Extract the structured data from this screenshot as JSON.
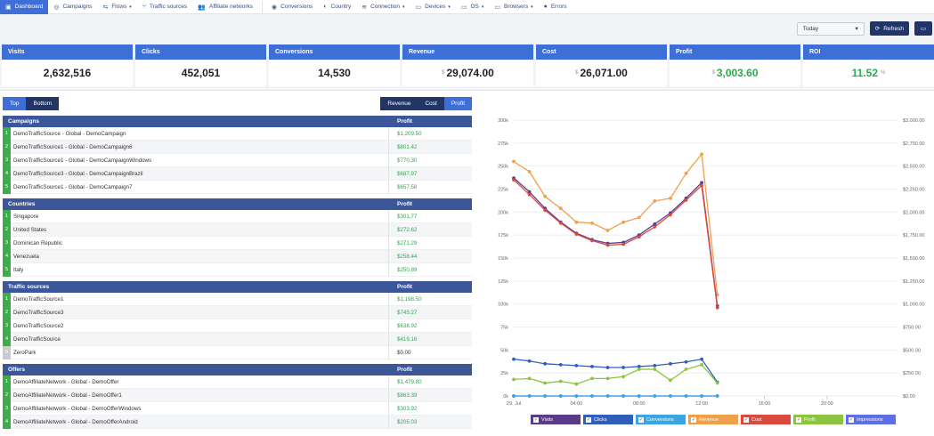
{
  "nav": {
    "items": [
      {
        "label": "Dashboard",
        "icon": "dashboard-icon",
        "glyph": "▣",
        "active": true,
        "caret": false
      },
      {
        "label": "Campaigns",
        "icon": "globe-icon",
        "glyph": "◎",
        "active": false,
        "caret": false
      },
      {
        "label": "Flows",
        "icon": "flows-icon",
        "glyph": "⇆",
        "active": false,
        "caret": true
      },
      {
        "label": "Traffic sources",
        "icon": "traffic-icon",
        "glyph": "⑂",
        "active": false,
        "caret": false
      },
      {
        "label": "Affiliate networks",
        "icon": "users-icon",
        "glyph": "👥",
        "active": false,
        "caret": false
      },
      {
        "label": "Conversions",
        "icon": "conversions-icon",
        "glyph": "◉",
        "active": false,
        "caret": false
      },
      {
        "label": "Country",
        "icon": "country-icon",
        "glyph": "◐",
        "active": false,
        "caret": false
      },
      {
        "label": "Connection",
        "icon": "wifi-icon",
        "glyph": "≋",
        "active": false,
        "caret": true
      },
      {
        "label": "Devices",
        "icon": "devices-icon",
        "glyph": "▭",
        "active": false,
        "caret": true
      },
      {
        "label": "OS",
        "icon": "os-icon",
        "glyph": "▭",
        "active": false,
        "caret": true
      },
      {
        "label": "Browsers",
        "icon": "browsers-icon",
        "glyph": "▭",
        "active": false,
        "caret": true
      },
      {
        "label": "Errors",
        "icon": "errors-icon",
        "glyph": "●",
        "active": false,
        "caret": false
      }
    ]
  },
  "toolbar": {
    "range": "Today",
    "refresh": "Refresh"
  },
  "stats": [
    {
      "label": "Visits",
      "value": "2,632,516",
      "currency": "",
      "suffix": "",
      "positive": false
    },
    {
      "label": "Clicks",
      "value": "452,051",
      "currency": "",
      "suffix": "",
      "positive": false
    },
    {
      "label": "Conversions",
      "value": "14,530",
      "currency": "",
      "suffix": "",
      "positive": false
    },
    {
      "label": "Revenue",
      "value": "29,074.00",
      "currency": "$",
      "suffix": "",
      "positive": false
    },
    {
      "label": "Cost",
      "value": "26,071.00",
      "currency": "$",
      "suffix": "",
      "positive": false
    },
    {
      "label": "Profit",
      "value": "3,003.60",
      "currency": "$",
      "suffix": "",
      "positive": true
    },
    {
      "label": "ROI",
      "value": "11.52",
      "currency": "",
      "suffix": "%",
      "positive": true
    }
  ],
  "tabs_left": [
    {
      "label": "Top",
      "active": true
    },
    {
      "label": "Bottom",
      "active": false
    }
  ],
  "tabs_right": [
    {
      "label": "Revenue",
      "active": false
    },
    {
      "label": "Cost",
      "active": false
    },
    {
      "label": "Profit",
      "active": true
    }
  ],
  "reports": [
    {
      "title": "Campaigns",
      "metric": "Profit",
      "rows": [
        {
          "rank": "1",
          "name": "DemoTrafficSource - Global - DemoCampaign",
          "value": "$1,209.50"
        },
        {
          "rank": "2",
          "name": "DemoTrafficSource1 - Global - DemoCampaign6",
          "value": "$801.42"
        },
        {
          "rank": "3",
          "name": "DemoTrafficSource1 - Global - DemoCampaignWindows",
          "value": "$770.30"
        },
        {
          "rank": "4",
          "name": "DemoTrafficSource3 - Global - DemoCampaignBrazil",
          "value": "$687.97"
        },
        {
          "rank": "5",
          "name": "DemoTrafficSource1 - Global - DemoCampaign7",
          "value": "$657.58"
        }
      ]
    },
    {
      "title": "Countries",
      "metric": "Profit",
      "rows": [
        {
          "rank": "1",
          "name": "Singapore",
          "value": "$301.77"
        },
        {
          "rank": "2",
          "name": "United States",
          "value": "$272.62"
        },
        {
          "rank": "3",
          "name": "Dominican Republic",
          "value": "$271.29"
        },
        {
          "rank": "4",
          "name": "Venezuela",
          "value": "$258.44"
        },
        {
          "rank": "5",
          "name": "Italy",
          "value": "$250.89"
        }
      ]
    },
    {
      "title": "Traffic sources",
      "metric": "Profit",
      "rows": [
        {
          "rank": "1",
          "name": "DemoTrafficSource1",
          "value": "$1,198.50"
        },
        {
          "rank": "2",
          "name": "DemoTrafficSource3",
          "value": "$745.27"
        },
        {
          "rank": "3",
          "name": "DemoTrafficSource2",
          "value": "$638.92"
        },
        {
          "rank": "4",
          "name": "DemoTrafficSource",
          "value": "$419.16"
        },
        {
          "rank": "5",
          "name": "ZeroPark",
          "value": "$0.00",
          "grey": true
        }
      ]
    },
    {
      "title": "Offers",
      "metric": "Profit",
      "rows": [
        {
          "rank": "1",
          "name": "DemoAffiliateNetwork - Global - DemoOffer",
          "value": "$1,479.80"
        },
        {
          "rank": "2",
          "name": "DemoAffiliateNetwork - Global - DemoOffer1",
          "value": "$863.39"
        },
        {
          "rank": "3",
          "name": "DemoAffiliateNetwork - Global - DemoOfferWindows",
          "value": "$303.92"
        },
        {
          "rank": "4",
          "name": "DemoAffiliateNetwork - Global - DemoOfferAndroid",
          "value": "$205.03"
        }
      ]
    }
  ],
  "chart_data": {
    "type": "line",
    "x_ticks": [
      "29. Jul",
      "04:00",
      "08:00",
      "12:00",
      "16:00",
      "20:00"
    ],
    "y_left_ticks": [
      "0k",
      "25k",
      "50k",
      "75k",
      "100k",
      "125k",
      "150k",
      "175k",
      "200k",
      "225k",
      "250k",
      "275k",
      "300k"
    ],
    "y_right_ticks": [
      "$0.00",
      "$250.00",
      "$500.00",
      "$750.00",
      "$1,000.00",
      "$1,250.00",
      "$1,500.00",
      "$1,750.00",
      "$2,000.00",
      "$2,250.00",
      "$2,500.00",
      "$2,750.00",
      "$3,000.00"
    ],
    "ylim_left": [
      0,
      300000
    ],
    "ylim_right": [
      0,
      3000
    ],
    "x_hours": [
      0,
      1,
      2,
      3,
      4,
      5,
      6,
      7,
      8,
      9,
      10,
      11,
      12,
      13
    ],
    "series": [
      {
        "name": "Visits",
        "axis": "left",
        "color": "#5b3a8c",
        "values": [
          237000,
          222000,
          204000,
          189000,
          177000,
          170000,
          166000,
          167000,
          175000,
          187000,
          199000,
          215000,
          232000,
          98000
        ]
      },
      {
        "name": "Clicks",
        "axis": "left",
        "color": "#2f5fb8",
        "values": [
          40000,
          38000,
          35000,
          34000,
          33000,
          32000,
          31000,
          31000,
          32000,
          33000,
          35000,
          37000,
          40000,
          15000
        ]
      },
      {
        "name": "Conversions",
        "axis": "left",
        "color": "#3aa5e0",
        "values": [
          0,
          0,
          0,
          0,
          0,
          0,
          0,
          0,
          0,
          0,
          0,
          0,
          0,
          0
        ]
      },
      {
        "name": "Revenue",
        "axis": "right",
        "color": "#f0a04b",
        "values": [
          2550,
          2440,
          2170,
          2040,
          1890,
          1880,
          1800,
          1890,
          1940,
          2120,
          2150,
          2420,
          2630,
          1100
        ]
      },
      {
        "name": "Cost",
        "axis": "right",
        "color": "#d94a3d",
        "values": [
          2350,
          2190,
          2020,
          1880,
          1760,
          1690,
          1640,
          1650,
          1730,
          1840,
          1970,
          2130,
          2290,
          960
        ]
      },
      {
        "name": "Profit",
        "axis": "right",
        "color": "#8dc43f",
        "values": [
          180,
          190,
          140,
          160,
          130,
          190,
          190,
          210,
          290,
          290,
          170,
          290,
          340,
          140
        ]
      },
      {
        "name": "Impressions",
        "axis": "left",
        "color": "#5d6ee8",
        "values": [
          0,
          0,
          0,
          0,
          0,
          0,
          0,
          0,
          0,
          0,
          0,
          0,
          0,
          0
        ]
      }
    ],
    "legend": [
      {
        "label": "Visits",
        "color": "#5b3a8c"
      },
      {
        "label": "Clicks",
        "color": "#2f5fb8"
      },
      {
        "label": "Conversions",
        "color": "#3aa5e0"
      },
      {
        "label": "Revenue",
        "color": "#f0a04b"
      },
      {
        "label": "Cost",
        "color": "#d94a3d"
      },
      {
        "label": "Profit",
        "color": "#8dc43f"
      },
      {
        "label": "Impressions",
        "color": "#5d6ee8"
      }
    ],
    "grid": true,
    "legend_position": "bottom"
  }
}
